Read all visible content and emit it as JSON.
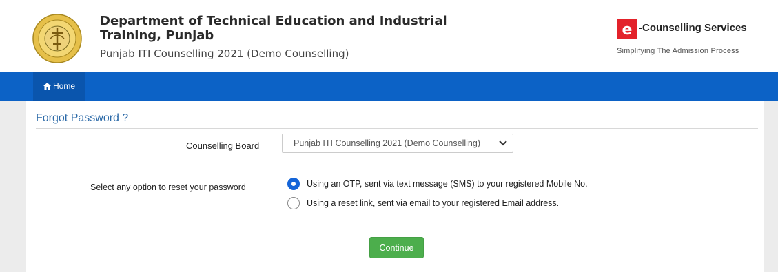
{
  "header": {
    "department_line1": "Department of Technical Education and Industrial",
    "department_line2": "Training, Punjab",
    "subtitle": "Punjab ITI Counselling 2021 (Demo Counselling)",
    "emblem_icon": "punjab-govt-emblem-icon",
    "brand_icon": "e-logo-icon",
    "brand_name": "-Counselling Services",
    "brand_tagline": "Simplifying The Admission Process",
    "brand_color": "#e3222a"
  },
  "navbar": {
    "home_icon": "home-icon",
    "home_label": "Home",
    "color": "#0c62c6"
  },
  "form": {
    "title": "Forgot Password ?",
    "board_label": "Counselling Board",
    "board_selected": "Punjab ITI Counselling 2021 (Demo Counselling)",
    "options_label": "Select any option to reset your password",
    "option_sms": "Using an OTP, sent via text message (SMS) to your registered Mobile No.",
    "option_email": "Using a reset link, sent via email to your registered Email address.",
    "selected_option": "sms",
    "continue_label": "Continue",
    "continue_color": "#4cae4c"
  }
}
